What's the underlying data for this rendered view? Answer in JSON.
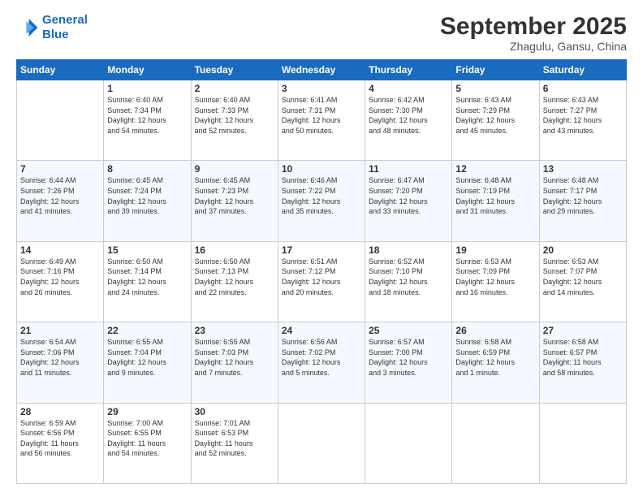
{
  "logo": {
    "line1": "General",
    "line2": "Blue"
  },
  "header": {
    "month": "September 2025",
    "location": "Zhagulu, Gansu, China"
  },
  "weekdays": [
    "Sunday",
    "Monday",
    "Tuesday",
    "Wednesday",
    "Thursday",
    "Friday",
    "Saturday"
  ],
  "weeks": [
    [
      {
        "day": "",
        "info": ""
      },
      {
        "day": "1",
        "info": "Sunrise: 6:40 AM\nSunset: 7:34 PM\nDaylight: 12 hours\nand 54 minutes."
      },
      {
        "day": "2",
        "info": "Sunrise: 6:40 AM\nSunset: 7:33 PM\nDaylight: 12 hours\nand 52 minutes."
      },
      {
        "day": "3",
        "info": "Sunrise: 6:41 AM\nSunset: 7:31 PM\nDaylight: 12 hours\nand 50 minutes."
      },
      {
        "day": "4",
        "info": "Sunrise: 6:42 AM\nSunset: 7:30 PM\nDaylight: 12 hours\nand 48 minutes."
      },
      {
        "day": "5",
        "info": "Sunrise: 6:43 AM\nSunset: 7:29 PM\nDaylight: 12 hours\nand 45 minutes."
      },
      {
        "day": "6",
        "info": "Sunrise: 6:43 AM\nSunset: 7:27 PM\nDaylight: 12 hours\nand 43 minutes."
      }
    ],
    [
      {
        "day": "7",
        "info": "Sunrise: 6:44 AM\nSunset: 7:26 PM\nDaylight: 12 hours\nand 41 minutes."
      },
      {
        "day": "8",
        "info": "Sunrise: 6:45 AM\nSunset: 7:24 PM\nDaylight: 12 hours\nand 39 minutes."
      },
      {
        "day": "9",
        "info": "Sunrise: 6:45 AM\nSunset: 7:23 PM\nDaylight: 12 hours\nand 37 minutes."
      },
      {
        "day": "10",
        "info": "Sunrise: 6:46 AM\nSunset: 7:22 PM\nDaylight: 12 hours\nand 35 minutes."
      },
      {
        "day": "11",
        "info": "Sunrise: 6:47 AM\nSunset: 7:20 PM\nDaylight: 12 hours\nand 33 minutes."
      },
      {
        "day": "12",
        "info": "Sunrise: 6:48 AM\nSunset: 7:19 PM\nDaylight: 12 hours\nand 31 minutes."
      },
      {
        "day": "13",
        "info": "Sunrise: 6:48 AM\nSunset: 7:17 PM\nDaylight: 12 hours\nand 29 minutes."
      }
    ],
    [
      {
        "day": "14",
        "info": "Sunrise: 6:49 AM\nSunset: 7:16 PM\nDaylight: 12 hours\nand 26 minutes."
      },
      {
        "day": "15",
        "info": "Sunrise: 6:50 AM\nSunset: 7:14 PM\nDaylight: 12 hours\nand 24 minutes."
      },
      {
        "day": "16",
        "info": "Sunrise: 6:50 AM\nSunset: 7:13 PM\nDaylight: 12 hours\nand 22 minutes."
      },
      {
        "day": "17",
        "info": "Sunrise: 6:51 AM\nSunset: 7:12 PM\nDaylight: 12 hours\nand 20 minutes."
      },
      {
        "day": "18",
        "info": "Sunrise: 6:52 AM\nSunset: 7:10 PM\nDaylight: 12 hours\nand 18 minutes."
      },
      {
        "day": "19",
        "info": "Sunrise: 6:53 AM\nSunset: 7:09 PM\nDaylight: 12 hours\nand 16 minutes."
      },
      {
        "day": "20",
        "info": "Sunrise: 6:53 AM\nSunset: 7:07 PM\nDaylight: 12 hours\nand 14 minutes."
      }
    ],
    [
      {
        "day": "21",
        "info": "Sunrise: 6:54 AM\nSunset: 7:06 PM\nDaylight: 12 hours\nand 11 minutes."
      },
      {
        "day": "22",
        "info": "Sunrise: 6:55 AM\nSunset: 7:04 PM\nDaylight: 12 hours\nand 9 minutes."
      },
      {
        "day": "23",
        "info": "Sunrise: 6:55 AM\nSunset: 7:03 PM\nDaylight: 12 hours\nand 7 minutes."
      },
      {
        "day": "24",
        "info": "Sunrise: 6:56 AM\nSunset: 7:02 PM\nDaylight: 12 hours\nand 5 minutes."
      },
      {
        "day": "25",
        "info": "Sunrise: 6:57 AM\nSunset: 7:00 PM\nDaylight: 12 hours\nand 3 minutes."
      },
      {
        "day": "26",
        "info": "Sunrise: 6:58 AM\nSunset: 6:59 PM\nDaylight: 12 hours\nand 1 minute."
      },
      {
        "day": "27",
        "info": "Sunrise: 6:58 AM\nSunset: 6:57 PM\nDaylight: 11 hours\nand 58 minutes."
      }
    ],
    [
      {
        "day": "28",
        "info": "Sunrise: 6:59 AM\nSunset: 6:56 PM\nDaylight: 11 hours\nand 56 minutes."
      },
      {
        "day": "29",
        "info": "Sunrise: 7:00 AM\nSunset: 6:55 PM\nDaylight: 11 hours\nand 54 minutes."
      },
      {
        "day": "30",
        "info": "Sunrise: 7:01 AM\nSunset: 6:53 PM\nDaylight: 11 hours\nand 52 minutes."
      },
      {
        "day": "",
        "info": ""
      },
      {
        "day": "",
        "info": ""
      },
      {
        "day": "",
        "info": ""
      },
      {
        "day": "",
        "info": ""
      }
    ]
  ]
}
